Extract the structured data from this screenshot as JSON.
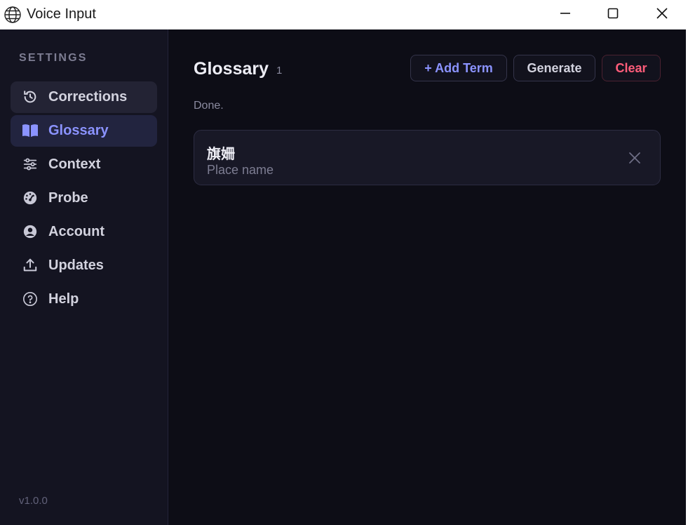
{
  "window": {
    "title": "Voice Input"
  },
  "sidebar": {
    "section_label": "SETTINGS",
    "items": [
      {
        "label": "Corrections",
        "icon": "history-icon",
        "state": "hover"
      },
      {
        "label": "Glossary",
        "icon": "book-icon",
        "state": "active"
      },
      {
        "label": "Context",
        "icon": "sliders-icon",
        "state": "normal"
      },
      {
        "label": "Probe",
        "icon": "gauge-icon",
        "state": "normal"
      },
      {
        "label": "Account",
        "icon": "user-circle-icon",
        "state": "normal"
      },
      {
        "label": "Updates",
        "icon": "upload-icon",
        "state": "normal"
      },
      {
        "label": "Help",
        "icon": "help-circle-icon",
        "state": "normal"
      }
    ],
    "version": "v1.0.0"
  },
  "main": {
    "title": "Glossary",
    "count": "1",
    "add_label": "+ Add Term",
    "generate_label": "Generate",
    "clear_label": "Clear",
    "status": "Done.",
    "terms": [
      {
        "word": "旗姍",
        "description": "Place name"
      }
    ]
  },
  "colors": {
    "background": "#0d0d16",
    "sidebar": "#141421",
    "accent": "#8b93ff",
    "danger": "#ff5d7a"
  }
}
